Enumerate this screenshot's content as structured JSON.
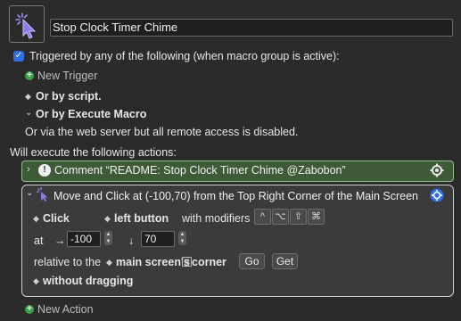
{
  "macro": {
    "title": "Stop Clock Timer Chime",
    "icon": "cursor-click-icon"
  },
  "trigger": {
    "checked": true,
    "label": "Triggered by any of the following (when macro group is active):",
    "new_trigger": "New Trigger",
    "by_script": "Or by script.",
    "by_execute_macro": "Or by Execute Macro",
    "web_server_note": "Or via the web server but all remote access is disabled."
  },
  "actions_header": "Will execute the following actions:",
  "comment_action": {
    "label": "Comment “README: Stop Clock Timer Chime @Zabobon”",
    "color": "#3f5a36"
  },
  "move_action": {
    "title": "Move and Click at (-100,70) from the Top Right Corner of the Main Screen",
    "click_type": "Click",
    "button": "left button",
    "with_modifiers": "with modifiers",
    "modifiers": [
      "^",
      "⌥",
      "⇧",
      "⌘"
    ],
    "at_label": "at",
    "right_arrow": "→",
    "down_arrow": "↓",
    "x": "-100",
    "y": "70",
    "relative_to": "relative to the",
    "relative_value": "main screen's",
    "corner": "corner",
    "get_label": "Get",
    "go_label": "Go",
    "drag": "without dragging"
  },
  "new_action": "New Action"
}
